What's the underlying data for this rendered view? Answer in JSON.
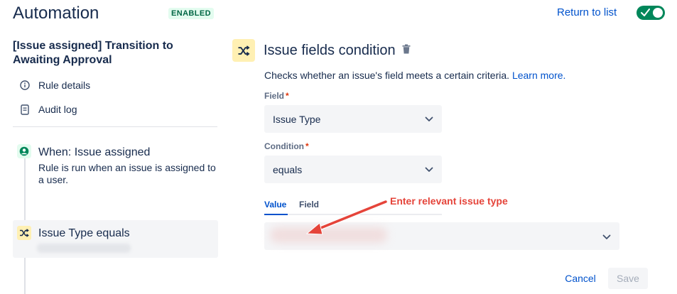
{
  "header": {
    "title": "Automation",
    "status_badge": "ENABLED",
    "return_link": "Return to list",
    "toggle_on": true
  },
  "sidebar": {
    "rule_title": "[Issue assigned] Transition to Awaiting Approval",
    "nav": [
      {
        "label": "Rule details",
        "icon": "info-icon"
      },
      {
        "label": "Audit log",
        "icon": "document-icon"
      }
    ],
    "trigger": {
      "title": "When: Issue assigned",
      "description": "Rule is run when an issue is assigned to a user.",
      "icon": "user-circle-icon"
    },
    "condition": {
      "title": "Issue Type equals",
      "icon": "shuffle-icon"
    }
  },
  "panel": {
    "title": "Issue fields condition",
    "description": "Checks whether an issue's field meets a certain criteria.",
    "learn_more": "Learn more.",
    "field_label": "Field",
    "field_value": "Issue Type",
    "condition_label": "Condition",
    "condition_value": "equals",
    "required_marker": "*",
    "tabs": [
      {
        "label": "Value",
        "active": true
      },
      {
        "label": "Field",
        "active": false
      }
    ],
    "annotation": "Enter relevant issue type",
    "cancel_label": "Cancel",
    "save_label": "Save"
  },
  "colors": {
    "primary_blue": "#0052cc",
    "toggle_green": "#00875a",
    "condition_yellow": "#fff0b3",
    "annotation_red": "#e5443a"
  }
}
